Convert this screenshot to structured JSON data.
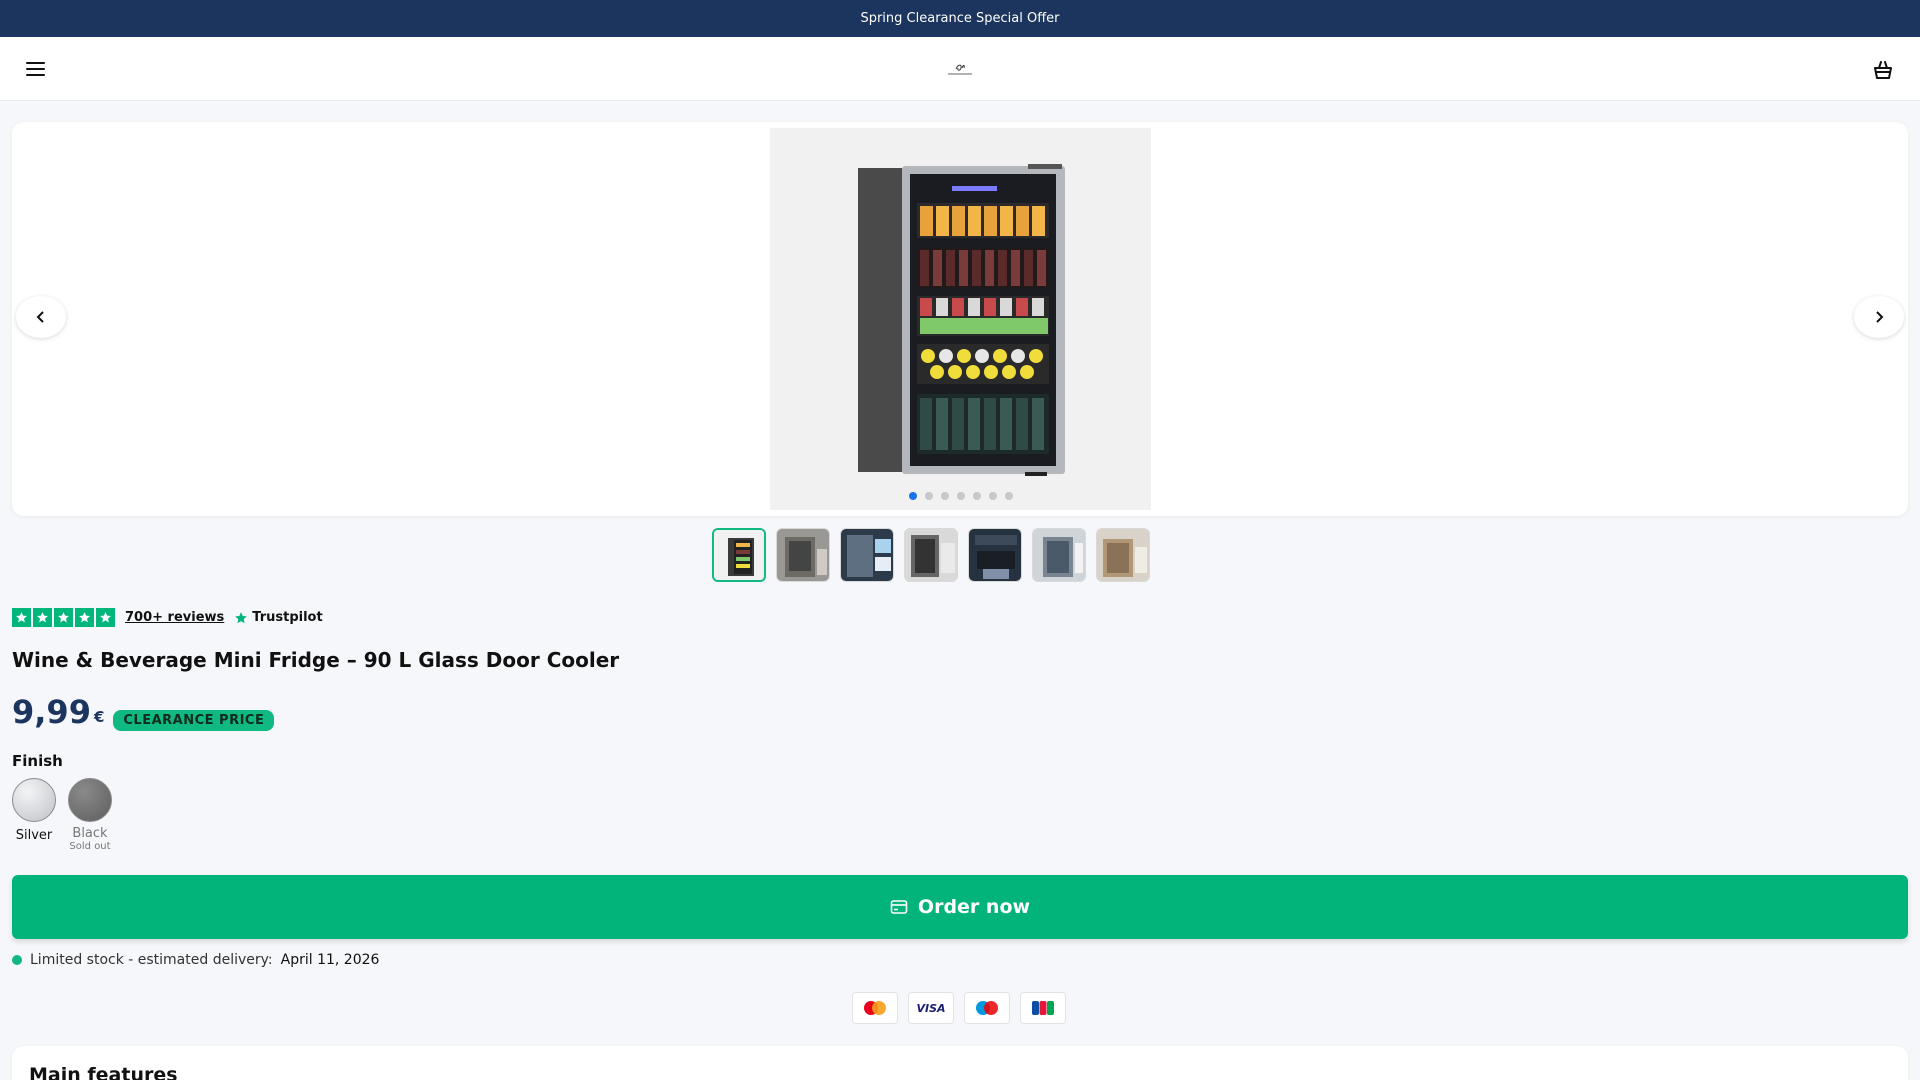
{
  "announcement": {
    "text": "Spring Clearance Special Offer"
  },
  "header": {
    "menu_icon": "hamburger-menu-icon",
    "logo_icon": "brand-logo",
    "cart_icon": "shopping-basket-icon"
  },
  "gallery": {
    "prev_icon": "chevron-left-icon",
    "next_icon": "chevron-right-icon",
    "slide_count": 7,
    "active_slide": 1,
    "thumbnail_count": 7
  },
  "rating": {
    "stars": 5,
    "reviews_label": "700+ reviews",
    "provider": "Trustpilot"
  },
  "product": {
    "title": "Wine & Beverage Mini Fridge – 90 L Glass Door Cooler",
    "price": "9,99",
    "currency": "€",
    "badge": "CLEARANCE PRICE"
  },
  "options": {
    "label": "Finish",
    "swatches": [
      {
        "name": "Silver",
        "status": "",
        "color": "#cfd1d4"
      },
      {
        "name": "Black",
        "status": "Sold out",
        "color": "#6b6b6b"
      }
    ]
  },
  "cta": {
    "label": "Order now",
    "icon": "credit-card-icon",
    "color": "#02b47a"
  },
  "stock": {
    "text": "Limited stock - estimated delivery:",
    "date": "April 11, 2026"
  },
  "payments": [
    "Mastercard",
    "VISA",
    "Maestro",
    "JCB"
  ],
  "features": {
    "title": "Main features"
  },
  "colors": {
    "announce_bg": "#1c355e",
    "accent": "#10b981",
    "trustpilot": "#00b67a"
  }
}
